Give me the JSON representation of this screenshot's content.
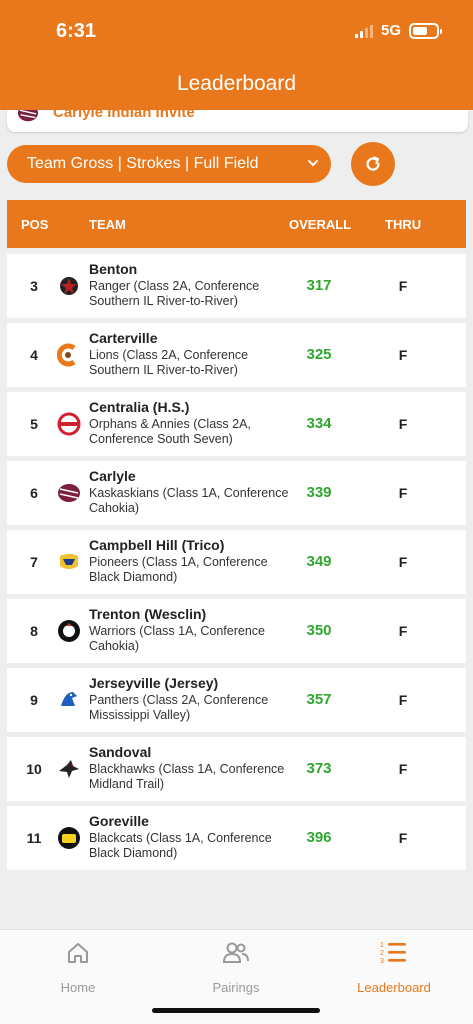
{
  "status_bar": {
    "time": "6:31",
    "network": "5G"
  },
  "header": {
    "title": "Leaderboard"
  },
  "event": {
    "name": "Carlyle Indian Invite"
  },
  "filter": {
    "label": "Team Gross | Strokes | Full Field"
  },
  "table": {
    "columns": {
      "pos": "POS",
      "team": "TEAM",
      "overall": "OVERALL",
      "thru": "THRU"
    },
    "rows": [
      {
        "pos": "3",
        "name": "Benton",
        "desc": "Ranger (Class 2A, Conference Southern IL River-to-River)",
        "score": "317",
        "thru": "F",
        "logo_color": "#b22222"
      },
      {
        "pos": "4",
        "name": "Carterville",
        "desc": "Lions (Class 2A, Conference Southern IL River-to-River)",
        "score": "325",
        "thru": "F",
        "logo_color": "#e8781b"
      },
      {
        "pos": "5",
        "name": "Centralia (H.S.)",
        "desc": "Orphans & Annies (Class 2A, Conference South Seven)",
        "score": "334",
        "thru": "F",
        "logo_color": "#d0202a"
      },
      {
        "pos": "6",
        "name": "Carlyle",
        "desc": "Kaskaskians (Class 1A, Conference Cahokia)",
        "score": "339",
        "thru": "F",
        "logo_color": "#7a1f3d"
      },
      {
        "pos": "7",
        "name": "Campbell Hill (Trico)",
        "desc": "Pioneers (Class 1A, Conference Black Diamond)",
        "score": "349",
        "thru": "F",
        "logo_color": "#f2c12e"
      },
      {
        "pos": "8",
        "name": "Trenton (Wesclin)",
        "desc": "Warriors (Class 1A, Conference Cahokia)",
        "score": "350",
        "thru": "F",
        "logo_color": "#c0392b"
      },
      {
        "pos": "9",
        "name": "Jerseyville (Jersey)",
        "desc": "Panthers (Class 2A, Conference Mississippi Valley)",
        "score": "357",
        "thru": "F",
        "logo_color": "#1f5fbf"
      },
      {
        "pos": "10",
        "name": "Sandoval",
        "desc": "Blackhawks (Class 1A, Conference Midland Trail)",
        "score": "373",
        "thru": "F",
        "logo_color": "#222222"
      },
      {
        "pos": "11",
        "name": "Goreville",
        "desc": "Blackcats (Class 1A, Conference Black Diamond)",
        "score": "396",
        "thru": "F",
        "logo_color": "#f2d21e"
      }
    ]
  },
  "bottom_nav": {
    "items": [
      {
        "label": "Home",
        "icon": "home-icon"
      },
      {
        "label": "Pairings",
        "icon": "pairings-icon"
      },
      {
        "label": "Leaderboard",
        "icon": "leaderboard-icon",
        "active": true
      }
    ]
  },
  "colors": {
    "accent": "#e8781b",
    "score": "#2ea82e"
  }
}
